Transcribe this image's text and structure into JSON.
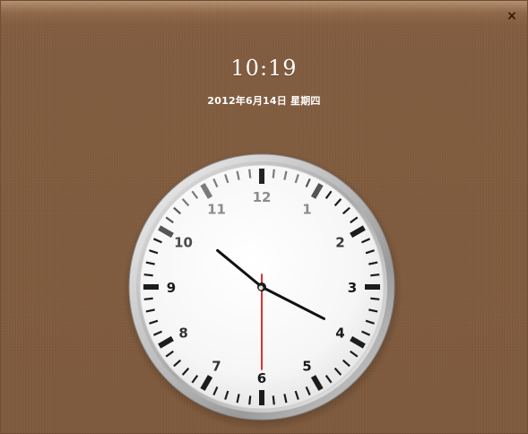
{
  "window": {
    "close_glyph": "×",
    "close_icon": "close-icon",
    "background_color": "#815c3f"
  },
  "digital": {
    "time": "10:19",
    "date": "2012年6月14日  星期四"
  },
  "analog": {
    "hour": 10,
    "minute": 19,
    "second": 30,
    "numerals": [
      "12",
      "1",
      "2",
      "3",
      "4",
      "5",
      "6",
      "7",
      "8",
      "9",
      "10",
      "11"
    ],
    "numeral_colors": {
      "12": "#8c8c8c",
      "1": "#8c8c8c",
      "2": "#3a3a3a",
      "3": "#1a1a1a",
      "4": "#1a1a1a",
      "5": "#1a1a1a",
      "6": "#1a1a1a",
      "7": "#333333",
      "8": "#333333",
      "9": "#1a1a1a",
      "10": "#4a4a4a",
      "11": "#8c8c8c"
    },
    "second_hand_color": "#d71c1c",
    "hand_color": "#111111"
  }
}
